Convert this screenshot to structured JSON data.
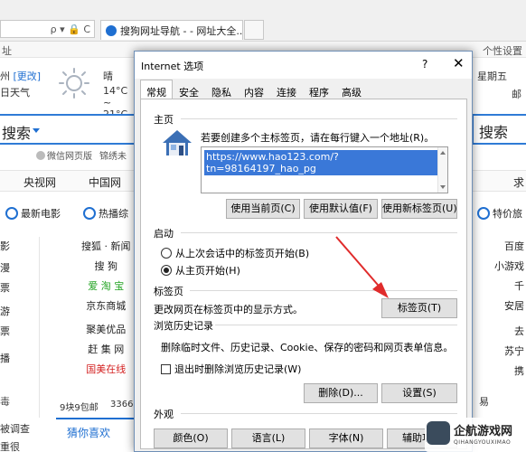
{
  "browser": {
    "addr_icons": "ρ ▾ 🔒 C",
    "tab_title": "搜狗网址导航 - - 网址大全...",
    "tab_close": "×"
  },
  "topbar": {
    "left": "址",
    "right": "个性设置"
  },
  "weather": {
    "city": "州",
    "change": "[更改]",
    "type": "日天气",
    "cond": "晴",
    "temp": "14°C ~ 21°C",
    "date_right": "星期五",
    "city_right": "邮"
  },
  "search": {
    "label": "搜索",
    "button": "搜索",
    "links": [
      "微信网页版",
      "锦绣未"
    ]
  },
  "nav": [
    "央视网",
    "中国网",
    "求"
  ],
  "iconrow": [
    "最新电影",
    "热播综",
    "特价旅"
  ],
  "sites_left": [
    "影",
    "漫",
    "票",
    "游",
    "票",
    "播"
  ],
  "sites_col1": [
    {
      "t": "搜狐 · 新闻",
      "c": "dark"
    },
    {
      "t": "搜 狗",
      "c": "dark"
    },
    {
      "t": "爱 淘 宝",
      "c": "green"
    },
    {
      "t": "京东商城",
      "c": "dark"
    },
    {
      "t": "聚美优品",
      "c": "dark"
    },
    {
      "t": "赶 集 网",
      "c": "dark"
    },
    {
      "t": "国美在线",
      "c": "red"
    }
  ],
  "sites_right": [
    "百度",
    "小游戏",
    "千",
    "安居",
    "去",
    "苏宁",
    "携"
  ],
  "bottom": {
    "left1": "9块9包邮",
    "left2": "3366",
    "left_side1": "毒",
    "left_side2": "被调查",
    "left_side3": "重很",
    "guess": "猜你喜欢",
    "yibao": "易"
  },
  "dialog": {
    "title": "Internet 选项",
    "help": "?",
    "close": "✕",
    "tabs": [
      "常规",
      "安全",
      "隐私",
      "内容",
      "连接",
      "程序",
      "高级"
    ],
    "home": {
      "header": "主页",
      "desc": "若要创建多个主标签页，请在每行键入一个地址(R)。",
      "url": "https://www.hao123.com/?tn=98164197_hao_pg",
      "btn_current": "使用当前页(C)",
      "btn_default": "使用默认值(F)",
      "btn_newtab": "使用新标签页(U)"
    },
    "startup": {
      "header": "启动",
      "opt1": "从上次会话中的标签页开始(B)",
      "opt2": "从主页开始(H)",
      "selected": 2
    },
    "tabsec": {
      "header": "标签页",
      "desc": "更改网页在标签页中的显示方式。",
      "btn": "标签页(T)"
    },
    "history": {
      "header": "浏览历史记录",
      "desc": "删除临时文件、历史记录、Cookie、保存的密码和网页表单信息。",
      "chk": "退出时删除浏览历史记录(W)",
      "btn_delete": "删除(D)...",
      "btn_settings": "设置(S)"
    },
    "appearance": {
      "header": "外观",
      "btn_colors": "颜色(O)",
      "btn_lang": "语言(L)",
      "btn_fonts": "字体(N)",
      "btn_access": "辅助功能"
    }
  },
  "watermark": {
    "title": "企航游戏网",
    "sub": "QIHANGYOUXIMAO"
  },
  "colors": {
    "accent": "#1f6fd1",
    "selection": "#3a78d8",
    "arrow": "#e02b2b"
  }
}
